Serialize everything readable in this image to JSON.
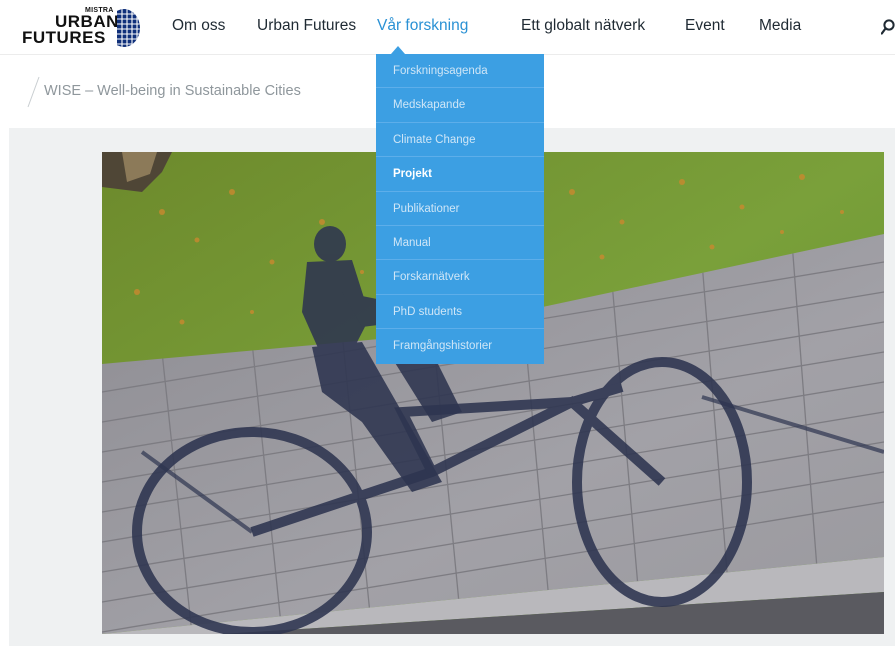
{
  "logo": {
    "line1": "MISTRA",
    "line2": "URBAN",
    "line3": "FUTURES"
  },
  "nav": {
    "items": [
      {
        "label": "Om oss"
      },
      {
        "label": "Urban Futures"
      },
      {
        "label": "Vår forskning",
        "active": true
      },
      {
        "label": "Ett globalt nätverk"
      },
      {
        "label": "Event"
      },
      {
        "label": "Media"
      }
    ],
    "search_icon": "search-icon"
  },
  "dropdown": {
    "items": [
      {
        "label": "Forskningsagenda"
      },
      {
        "label": "Medskapande"
      },
      {
        "label": "Climate Change"
      },
      {
        "label": "Projekt",
        "selected": true
      },
      {
        "label": "Publikationer"
      },
      {
        "label": "Manual"
      },
      {
        "label": "Forskarnätverk"
      },
      {
        "label": "PhD students"
      },
      {
        "label": "Framgångshistorier"
      }
    ]
  },
  "breadcrumb": {
    "current": "WISE – Well-being in Sustainable Cities"
  },
  "hero": {
    "subject": "bicycle-shadow-photo"
  },
  "colors": {
    "accent": "#2a91d4",
    "dropdown_bg": "#3c9fe3",
    "band_bg": "#eff1f2"
  }
}
